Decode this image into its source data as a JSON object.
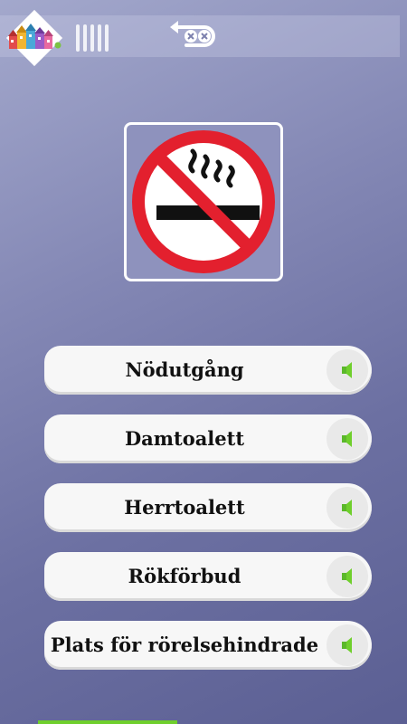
{
  "header": {
    "logo_icon": "colorful-houses-logo-icon",
    "progress_marks": 5,
    "undo_icon": "undo-arrow-icon"
  },
  "question": {
    "image_icon": "no-smoking-sign-icon"
  },
  "answers": [
    {
      "label": "Nödutgång",
      "sound_icon": "speaker-icon"
    },
    {
      "label": "Damtoalett",
      "sound_icon": "speaker-icon"
    },
    {
      "label": "Herrtoalett",
      "sound_icon": "speaker-icon"
    },
    {
      "label": "Rökförbud",
      "sound_icon": "speaker-icon"
    },
    {
      "label": "Plats för rörelsehindrade",
      "sound_icon": "speaker-icon"
    }
  ],
  "colors": {
    "accent_green": "#6fcf2c",
    "sign_red": "#e3202e"
  }
}
